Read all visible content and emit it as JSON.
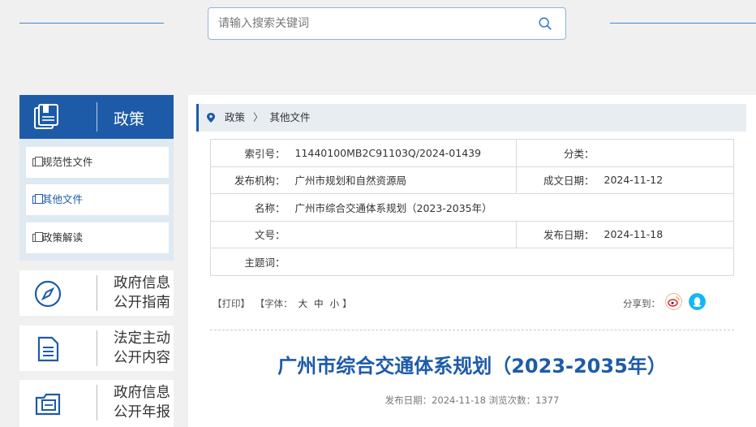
{
  "search": {
    "placeholder": "请输入搜索关键词"
  },
  "sidebar": {
    "header": "政策",
    "subitems": [
      {
        "label": "规范性文件"
      },
      {
        "label": "其他文件"
      },
      {
        "label": "政策解读"
      }
    ],
    "cards": [
      {
        "line1": "政府信息",
        "line2": "公开指南",
        "icon": "compass-icon"
      },
      {
        "line1": "法定主动",
        "line2": "公开内容",
        "icon": "document-icon"
      },
      {
        "line1": "政府信息",
        "line2": "公开年报",
        "icon": "folder-icon"
      }
    ]
  },
  "breadcrumb": {
    "root": "政策",
    "separator": "〉",
    "current": "其他文件"
  },
  "meta": {
    "index_label": "索引号：",
    "index_value": "11440100MB2C91103Q/2024-01439",
    "category_label": "分类：",
    "category_value": "",
    "issuer_label": "发布机构：",
    "issuer_value": "广州市规划和自然资源局",
    "written_label": "成文日期：",
    "written_value": "2024-11-12",
    "name_label": "名称：",
    "name_value": "广州市综合交通体系规划（2023-2035年）",
    "docno_label": "文号：",
    "docno_value": "",
    "pubdate_label": "发布日期：",
    "pubdate_value": "2024-11-18",
    "subject_label": "主题词：",
    "subject_value": ""
  },
  "tools": {
    "print": "【打印】",
    "font_prefix": "【字体：",
    "font_large": "大",
    "font_medium": "中",
    "font_small": "小",
    "font_suffix": "】",
    "share_label": "分享到："
  },
  "article": {
    "title": "广州市综合交通体系规划（2023-2035年）",
    "info": "发布日期：2024-11-18  浏览次数：1377"
  },
  "colors": {
    "brand": "#1d5ba8",
    "weibo": "#e6162d",
    "qq": "#12b7f5"
  }
}
